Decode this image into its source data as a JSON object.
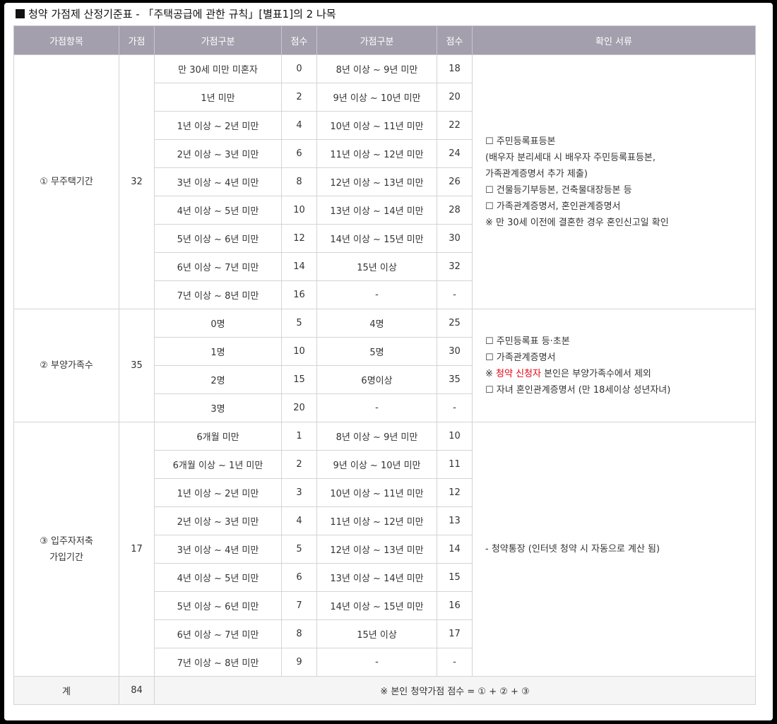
{
  "title": "청약 가점제 산정기준표 - 「주택공급에 관한 규칙」[별표1]의 2 나목",
  "headers": [
    "가점항목",
    "가점",
    "가점구분",
    "점수",
    "가점구분",
    "점수",
    "확인 서류"
  ],
  "sections": [
    {
      "item": "① 무주택기간",
      "points": "32",
      "rows": [
        [
          "만 30세 미만 미혼자",
          "0",
          "8년 이상 ~ 9년 미만",
          "18"
        ],
        [
          "1년 미만",
          "2",
          "9년 이상 ~ 10년 미만",
          "20"
        ],
        [
          "1년 이상 ~ 2년 미만",
          "4",
          "10년 이상 ~ 11년 미만",
          "22"
        ],
        [
          "2년 이상 ~ 3년 미만",
          "6",
          "11년 이상 ~ 12년 미만",
          "24"
        ],
        [
          "3년 이상 ~ 4년 미만",
          "8",
          "12년 이상 ~ 13년 미만",
          "26"
        ],
        [
          "4년 이상 ~ 5년 미만",
          "10",
          "13년 이상 ~ 14년 미만",
          "28"
        ],
        [
          "5년 이상 ~ 6년 미만",
          "12",
          "14년 이상 ~ 15년 미만",
          "30"
        ],
        [
          "6년 이상 ~ 7년 미만",
          "14",
          "15년 이상",
          "32"
        ],
        [
          "7년 이상 ~ 8년 미만",
          "16",
          "-",
          "-"
        ]
      ],
      "docs": [
        "☐ 주민등록표등본",
        "(배우자 분리세대 시 배우자 주민등록표등본,",
        "가족관계증명서 추가 제출)",
        "☐ 건물등기부등본, 건축물대장등본 등",
        "☐ 가족관계증명서, 혼인관계증명서",
        "※ 만 30세 이전에 결혼한 경우 혼인신고일 확인"
      ]
    },
    {
      "item": "② 부양가족수",
      "points": "35",
      "rows": [
        [
          "0명",
          "5",
          "4명",
          "25"
        ],
        [
          "1명",
          "10",
          "5명",
          "30"
        ],
        [
          "2명",
          "15",
          "6명이상",
          "35"
        ],
        [
          "3명",
          "20",
          "-",
          "-"
        ]
      ],
      "docs": [
        "☐ 주민등록표 등·초본",
        "☐ 가족관계증명서",
        "※ 청약 신청자 본인은 부양가족수에서 제외",
        "☐ 자녀 혼인관계증명서 (만 18세이상 성년자녀)"
      ],
      "docs_highlight": "청약 신청자"
    },
    {
      "item": "③ 입주자저축\n가입기간",
      "points": "17",
      "rows": [
        [
          "6개월 미만",
          "1",
          "8년 이상 ~ 9년 미만",
          "10"
        ],
        [
          "6개월 이상 ~ 1년 미만",
          "2",
          "9년 이상 ~ 10년 미만",
          "11"
        ],
        [
          "1년 이상 ~ 2년 미만",
          "3",
          "10년 이상 ~ 11년 미만",
          "12"
        ],
        [
          "2년 이상 ~ 3년 미만",
          "4",
          "11년 이상 ~ 12년 미만",
          "13"
        ],
        [
          "3년 이상 ~ 4년 미만",
          "5",
          "12년 이상 ~ 13년 미만",
          "14"
        ],
        [
          "4년 이상 ~ 5년 미만",
          "6",
          "13년 이상 ~ 14년 미만",
          "15"
        ],
        [
          "5년 이상 ~ 6년 미만",
          "7",
          "14년 이상 ~ 15년 미만",
          "16"
        ],
        [
          "6년 이상 ~ 7년 미만",
          "8",
          "15년 이상",
          "17"
        ],
        [
          "7년 이상 ~ 8년 미만",
          "9",
          "-",
          "-"
        ]
      ],
      "docs": [
        "- 청약통장 (인터넷 청약 시 자동으로 계산 됨)"
      ]
    }
  ],
  "total": {
    "label": "계",
    "points": "84",
    "note": "※ 본인 청약가점 점수 = ① + ② + ③"
  },
  "colors": {
    "header_bg": "#a39fad",
    "highlight": "#e60012"
  }
}
